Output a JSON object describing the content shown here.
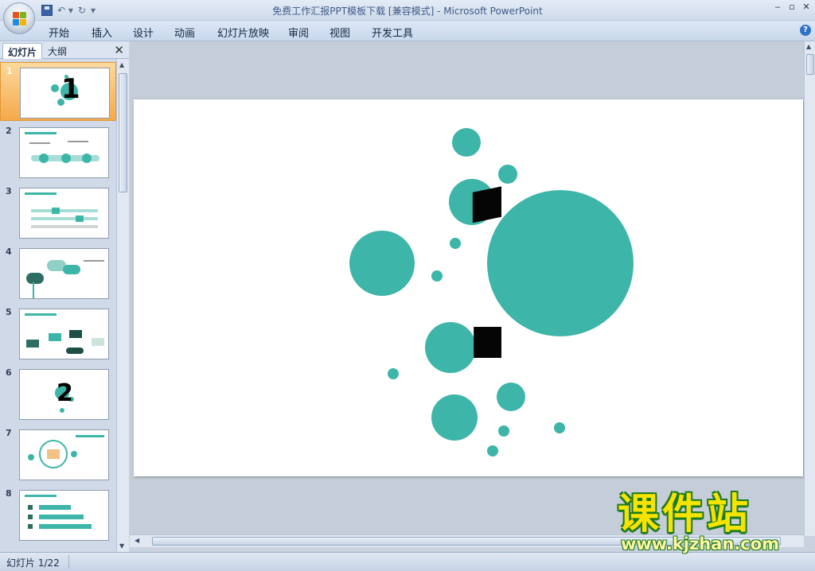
{
  "window": {
    "title": "免费工作汇报PPT模板下载 [兼容模式]",
    "separator": " - ",
    "app": "Microsoft PowerPoint"
  },
  "ribbon": {
    "tabs": [
      "开始",
      "插入",
      "设计",
      "动画",
      "幻灯片放映",
      "审阅",
      "视图",
      "开发工具"
    ]
  },
  "panel": {
    "tab_slides": "幻灯片",
    "tab_outline": "大纲",
    "thumbnails": [
      {
        "num": "1",
        "big": "1"
      },
      {
        "num": "2"
      },
      {
        "num": "3"
      },
      {
        "num": "4"
      },
      {
        "num": "5"
      },
      {
        "num": "6",
        "big": "2"
      },
      {
        "num": "7"
      },
      {
        "num": "8"
      }
    ]
  },
  "slide": {
    "number": "1",
    "accent_color": "#3db5a8"
  },
  "status": {
    "slide_counter": "幻灯片 1/22"
  },
  "watermark": {
    "brand": "课件站",
    "url": "www.kjzhan.com"
  },
  "icons": [
    "office-logo-icon",
    "save-icon",
    "undo-icon",
    "redo-icon",
    "customize-qat-icon",
    "help-icon",
    "close-panel-icon"
  ]
}
